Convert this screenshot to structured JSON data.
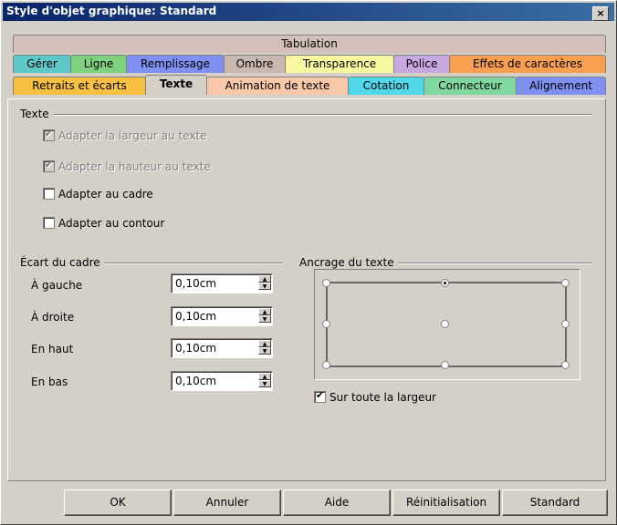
{
  "window": {
    "title": "Style d'objet graphique: Standard",
    "close": "×"
  },
  "tabs": {
    "row1": [
      {
        "label": "Tabulation",
        "color": "#d4c0b8"
      }
    ],
    "row2": [
      {
        "label": "Gérer",
        "color": "#5ec8c8"
      },
      {
        "label": "Ligne",
        "color": "#7ed27e"
      },
      {
        "label": "Remplissage",
        "color": "#8090f0"
      },
      {
        "label": "Ombre",
        "color": "#c8b8b0"
      },
      {
        "label": "Transparence",
        "color": "#f8f8a0"
      },
      {
        "label": "Police",
        "color": "#c8a8e0"
      },
      {
        "label": "Effets de caractères",
        "color": "#f8a050"
      }
    ],
    "row3": [
      {
        "label": "Retraits et écarts",
        "color": "#f8c040"
      },
      {
        "label": "Texte",
        "color": "#d4d0c8",
        "selected": true
      },
      {
        "label": "Animation de texte",
        "color": "#f8c8a8"
      },
      {
        "label": "Cotation",
        "color": "#50d8e8"
      },
      {
        "label": "Connecteur",
        "color": "#80d8a0"
      },
      {
        "label": "Alignement",
        "color": "#8090f0"
      }
    ]
  },
  "texte_group": {
    "label": "Texte",
    "adapter_largeur": {
      "label": "Adapter la largeur au texte",
      "checked": true,
      "disabled": true
    },
    "adapter_hauteur": {
      "label": "Adapter la hauteur au texte",
      "checked": true,
      "disabled": true
    },
    "adapter_cadre": {
      "label": "Adapter au cadre",
      "checked": false
    },
    "adapter_contour": {
      "label": "Adapter au contour",
      "checked": false
    }
  },
  "ecart_group": {
    "label": "Écart du cadre",
    "gauche": {
      "label": "À gauche",
      "value": "0,10cm"
    },
    "droite": {
      "label": "À droite",
      "value": "0,10cm"
    },
    "haut": {
      "label": "En haut",
      "value": "0,10cm"
    },
    "bas": {
      "label": "En bas",
      "value": "0,10cm"
    }
  },
  "ancrage_group": {
    "label": "Ancrage du texte",
    "selected_anchor": "top-center",
    "full_width": {
      "label": "Sur toute la largeur",
      "checked": true
    }
  },
  "buttons": {
    "ok": "OK",
    "cancel": "Annuler",
    "help": "Aide",
    "reset": "Réinitialisation",
    "standard": "Standard"
  }
}
